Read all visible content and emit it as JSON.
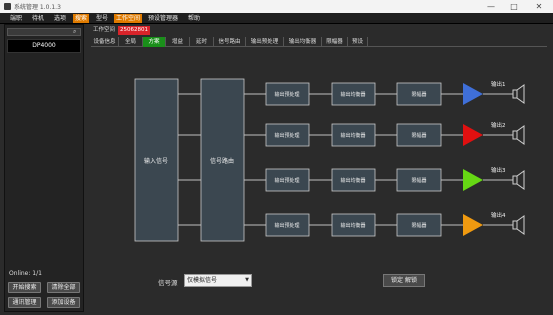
{
  "window": {
    "title": "系统管理 1.0.1.3",
    "minimize_glyph": "—",
    "maximize_glyph": "□",
    "close_glyph": "✕"
  },
  "menu": {
    "items": [
      {
        "label": "端职"
      },
      {
        "label": "待机"
      },
      {
        "label": "选项"
      },
      {
        "label": "搜索",
        "active": true
      },
      {
        "label": "型号"
      },
      {
        "label": "工作空间",
        "active": true
      },
      {
        "label": "预设管理器"
      },
      {
        "label": "帮助"
      }
    ]
  },
  "sidebar": {
    "device": "DP4000",
    "online": "Online: 1/1",
    "buttons": {
      "start_search": "开始搜索",
      "clear_all": "清除全部",
      "comm_manage": "通讯管理",
      "add_device": "添加设备"
    }
  },
  "workspace": {
    "label": "工作空间",
    "id": "25062801"
  },
  "subtabs": [
    {
      "label": "设备信息"
    },
    {
      "label": "全局"
    },
    {
      "label": "方案",
      "active": true
    },
    {
      "label": "增益"
    },
    {
      "label": "延时"
    },
    {
      "label": "信号路由"
    },
    {
      "label": "输出预处理"
    },
    {
      "label": "输出均衡器"
    },
    {
      "label": "限幅器"
    },
    {
      "label": "预设"
    }
  ],
  "diagram": {
    "input_block": "输入信号",
    "router_block": "信号路由",
    "channels": [
      {
        "pre": "输出预处理",
        "eq": "输出均衡器",
        "limiter": "限幅器",
        "out": "输出1",
        "color": "#3f6fd8"
      },
      {
        "pre": "输出预处理",
        "eq": "输出均衡器",
        "limiter": "限幅器",
        "out": "输出2",
        "color": "#e01010"
      },
      {
        "pre": "输出预处理",
        "eq": "输出均衡器",
        "limiter": "限幅器",
        "out": "输出3",
        "color": "#66d814"
      },
      {
        "pre": "输出预处理",
        "eq": "输出均衡器",
        "limiter": "限幅器",
        "out": "输出4",
        "color": "#f09a10"
      }
    ]
  },
  "footer": {
    "source_label": "信号源",
    "source_value": "仅模拟信号",
    "lock_button": "锁定 解锁"
  },
  "colors": {
    "accent_orange": "#e07b00",
    "accent_red": "#d8232a",
    "tab_active_green": "#1a8f1a",
    "block_fill": "#3b4750",
    "block_stroke": "#c8c8c8"
  }
}
